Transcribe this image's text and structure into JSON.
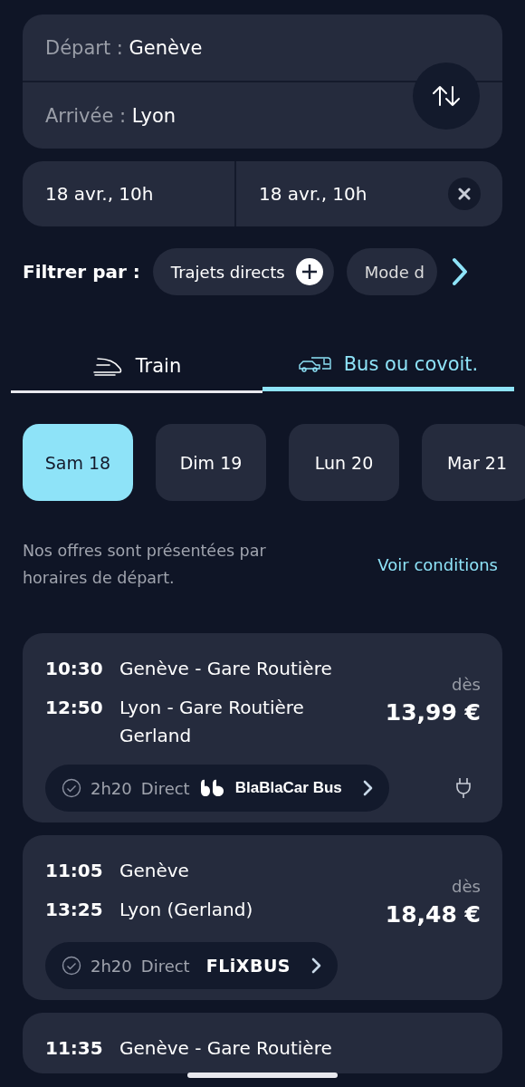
{
  "route": {
    "from_label": "Départ :",
    "from": "Genève",
    "to_label": "Arrivée :",
    "to": "Lyon"
  },
  "dates": {
    "outbound": "18 avr., 10h",
    "return": "18 avr., 10h"
  },
  "filters": {
    "label": "Filtrer par :",
    "chips": [
      {
        "label": "Trajets directs",
        "kind": "add"
      },
      {
        "label": "Mode d",
        "kind": "faded"
      }
    ]
  },
  "tabs": [
    {
      "label": "Train",
      "kind": "train",
      "selected": false
    },
    {
      "label": "Bus ou covoit.",
      "kind": "bus",
      "selected": true
    }
  ],
  "days": [
    {
      "label": "Sam 18",
      "selected": true
    },
    {
      "label": "Dim 19",
      "selected": false
    },
    {
      "label": "Lun 20",
      "selected": false
    },
    {
      "label": "Mar 21",
      "selected": false
    }
  ],
  "note": {
    "text": "Nos offres sont présentées par horaires de départ.",
    "link": "Voir conditions"
  },
  "offers": [
    {
      "dep_time": "10:30",
      "dep": "Genève - Gare Routière",
      "arr_time": "12:50",
      "arr": "Lyon - Gare Routière Gerland",
      "from_label": "dès",
      "price": "13,99 €",
      "duration": "2h20",
      "type": "Direct",
      "operator": "BlaBlaCar Bus",
      "kind": "blablacar",
      "plug": true
    },
    {
      "dep_time": "11:05",
      "dep": "Genève",
      "arr_time": "13:25",
      "arr": "Lyon (Gerland)",
      "from_label": "dès",
      "price": "18,48 €",
      "duration": "2h20",
      "type": "Direct",
      "operator": "FLiXBUS",
      "kind": "flixbus",
      "plug": false
    },
    {
      "dep_time": "11:35",
      "dep": "Genève - Gare Routière"
    }
  ]
}
